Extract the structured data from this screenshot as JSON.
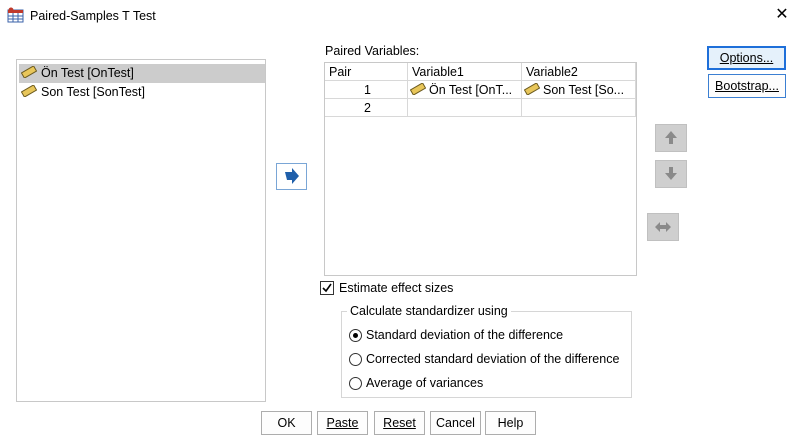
{
  "window": {
    "title": "Paired-Samples T Test",
    "close_glyph": "✕"
  },
  "source_list": {
    "items": [
      {
        "label": "Ön Test [OnTest]",
        "selected": true
      },
      {
        "label": "Son Test [SonTest]",
        "selected": false
      }
    ]
  },
  "paired": {
    "label": "Paired Variables:",
    "columns": [
      "Pair",
      "Variable1",
      "Variable2"
    ],
    "rows": [
      {
        "pair": "1",
        "var1": "Ön Test [OnT...",
        "var2": "Son Test [So..."
      },
      {
        "pair": "2",
        "var1": "",
        "var2": ""
      }
    ]
  },
  "effect_sizes": {
    "label": "Estimate effect sizes",
    "checked": true
  },
  "standardizer": {
    "title": "Calculate standardizer using",
    "options": [
      {
        "label": "Standard deviation of the difference",
        "selected": true
      },
      {
        "label": "Corrected standard deviation of the difference",
        "selected": false
      },
      {
        "label": "Average of variances",
        "selected": false
      }
    ]
  },
  "side_buttons": {
    "options": "Options...",
    "bootstrap": "Bootstrap..."
  },
  "bottom_buttons": {
    "ok": "OK",
    "paste": "Paste",
    "reset": "Reset",
    "cancel": "Cancel",
    "help": "Help"
  },
  "icons": {
    "ruler": "ruler-icon",
    "move_right": "arrow-right-icon",
    "move_up": "arrow-up-icon",
    "move_down": "arrow-down-icon",
    "swap": "swap-icon"
  },
  "colors": {
    "accent": "#1e6fd9",
    "selected_row": "#cccccc",
    "disabled_button": "#cfcfcf"
  }
}
